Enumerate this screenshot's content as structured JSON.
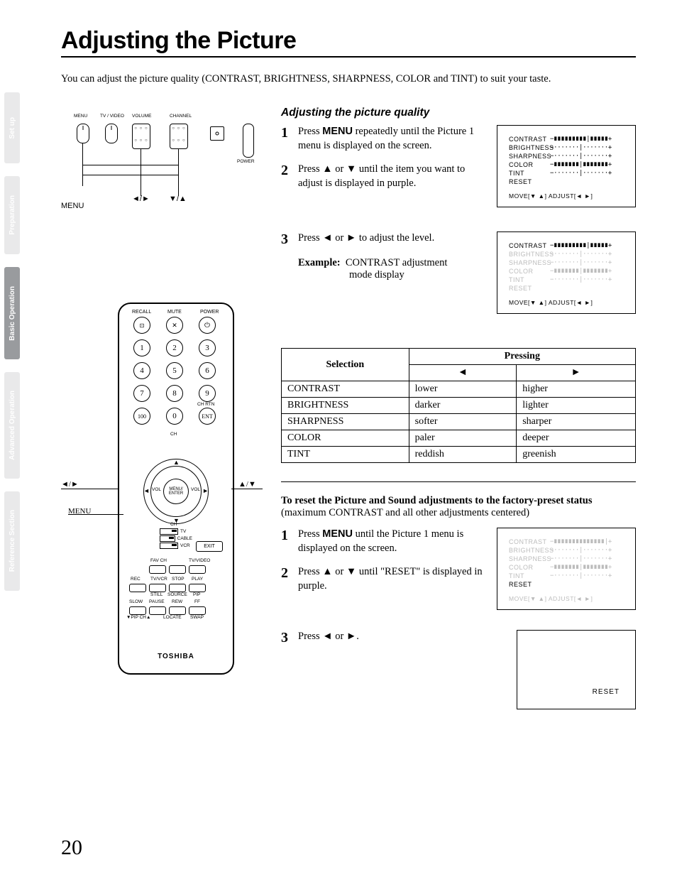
{
  "side_tabs": {
    "setup": "Set up",
    "prep": "Preparation",
    "basic": "Basic Operation",
    "adv": "Advanced Operation",
    "ref": "Reference Section"
  },
  "title": "Adjusting the Picture",
  "intro": "You can adjust the picture quality (CONTRAST, BRIGHTNESS, SHARPNESS, COLOR and TINT) to suit your taste.",
  "tv_labels": {
    "menu": "MENU",
    "tvvideo": "TV / VIDEO",
    "volume": "VOLUME",
    "channel": "CHANNEL",
    "power": "POWER"
  },
  "callouts": {
    "menu": "MENU",
    "lr": "◄/►",
    "ud": "▼/▲",
    "ud2": "▲/▼"
  },
  "remote_labels": {
    "recall": "RECALL",
    "mute": "MUTE",
    "power": "POWER",
    "chrtn": "CH RTN",
    "ch": "CH",
    "vol": "VOL",
    "menu_enter": "MENU/\nENTER",
    "tv": "TV",
    "cable": "CABLE",
    "vcr": "VCR",
    "exit": "EXIT",
    "favch": "FAV CH",
    "tvvideo": "TV/VIDEO",
    "rec": "REC",
    "tvvcr": "TV/VCR",
    "stop": "STOP",
    "play": "PLAY",
    "still": "STILL",
    "source": "SOURCE",
    "pip": "PIP",
    "slow": "SLOW",
    "pause": "PAUSE",
    "rew": "REW",
    "ff": "FF",
    "pipch": "▼PIP CH▲",
    "locate": "LOCATE",
    "swap": "SWAP",
    "brand": "TOSHIBA",
    "ent": "ENT",
    "hundred": "100"
  },
  "section1": {
    "heading": "Adjusting the picture quality",
    "step1_a": "Press ",
    "step1_menu": "MENU",
    "step1_b": " repeatedly until the Picture 1 menu is displayed on the screen.",
    "step2": "Press ▲ or ▼ until the item you want to adjust is displayed in purple.",
    "step3": "Press ◄ or ► to adjust the level.",
    "example_label": "Example:",
    "example_text1": "CONTRAST adjustment",
    "example_text2": "mode display"
  },
  "osd": {
    "items": [
      "CONTRAST",
      "BRIGHTNESS",
      "SHARPNESS",
      "COLOR",
      "TINT",
      "RESET"
    ],
    "footer": "MOVE[▼ ▲]  ADJUST[◄ ►]"
  },
  "table": {
    "selection": "Selection",
    "pressing": "Pressing",
    "left": "◄",
    "right": "►",
    "rows": [
      {
        "s": "CONTRAST",
        "l": "lower",
        "r": "higher"
      },
      {
        "s": "BRIGHTNESS",
        "l": "darker",
        "r": "lighter"
      },
      {
        "s": "SHARPNESS",
        "l": "softer",
        "r": "sharper"
      },
      {
        "s": "COLOR",
        "l": "paler",
        "r": "deeper"
      },
      {
        "s": "TINT",
        "l": "reddish",
        "r": "greenish"
      }
    ]
  },
  "reset": {
    "heading": "To reset the Picture and Sound adjustments to the factory-preset status",
    "sub": "(maximum CONTRAST and all other adjustments centered)",
    "step1_a": "Press ",
    "step1_menu": "MENU",
    "step1_b": " until the Picture 1 menu is displayed on the screen.",
    "step2": "Press ▲ or ▼ until \"RESET\" is displayed in purple.",
    "step3": "Press ◄ or ►.",
    "box": "RESET"
  },
  "page_number": "20"
}
